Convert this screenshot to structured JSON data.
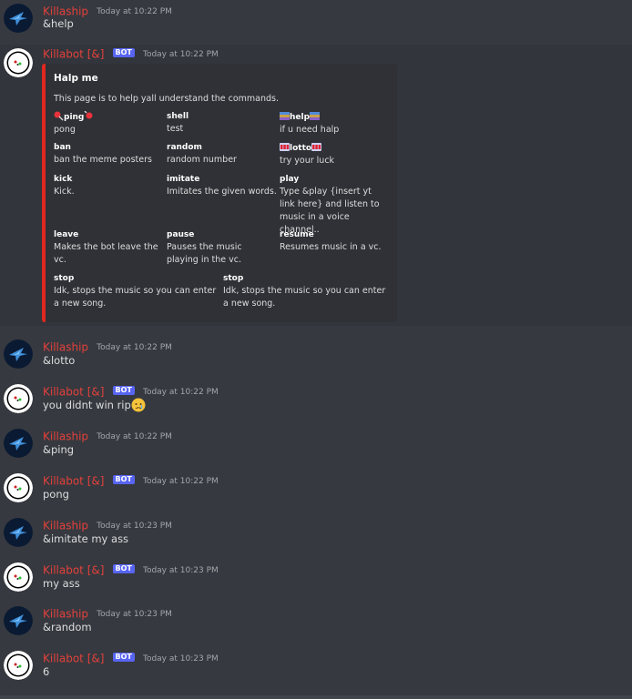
{
  "messages": [
    {
      "user": "Killaship",
      "bot": false,
      "time": "Today at 10:22 PM",
      "text": "&help"
    },
    {
      "user": "Killabot [&]",
      "bot": true,
      "time": "Today at 10:22 PM",
      "text": ""
    },
    {
      "user": "Killaship",
      "bot": false,
      "time": "Today at 10:22 PM",
      "text": "&lotto"
    },
    {
      "user": "Killabot [&]",
      "bot": true,
      "time": "Today at 10:22 PM",
      "text": "you didnt win rip"
    },
    {
      "user": "Killaship",
      "bot": false,
      "time": "Today at 10:22 PM",
      "text": "&ping"
    },
    {
      "user": "Killabot [&]",
      "bot": true,
      "time": "Today at 10:22 PM",
      "text": "pong"
    },
    {
      "user": "Killaship",
      "bot": false,
      "time": "Today at 10:23 PM",
      "text": "&imitate my ass"
    },
    {
      "user": "Killabot [&]",
      "bot": true,
      "time": "Today at 10:23 PM",
      "text": "my ass"
    },
    {
      "user": "Killaship",
      "bot": false,
      "time": "Today at 10:23 PM",
      "text": "&random"
    },
    {
      "user": "Killabot [&]",
      "bot": true,
      "time": "Today at 10:23 PM",
      "text": "6"
    }
  ],
  "bot_tag": "BOT",
  "embed": {
    "title": "Halp me",
    "description": "This page is to help yall understand the commands.",
    "accent_color": "#e0281f",
    "fields": [
      {
        "name": "ping",
        "value": "pong",
        "emoji": "lollipop-icon"
      },
      {
        "name": "shell",
        "value": "test"
      },
      {
        "name": "help",
        "value": "if u need halp",
        "emoji": "books-icon"
      },
      {
        "name": "ban",
        "value": "ban the meme posters"
      },
      {
        "name": "random",
        "value": "random number"
      },
      {
        "name": "lotto",
        "value": "try your luck",
        "emoji": "slot-icon"
      },
      {
        "name": "kick",
        "value": "Kick."
      },
      {
        "name": "imitate",
        "value": "Imitates the given words."
      },
      {
        "name": "play",
        "value": "Type &play {insert yt link here} and listen to music in a voice channel.."
      },
      {
        "name": "leave",
        "value": "Makes the bot leave the vc."
      },
      {
        "name": "pause",
        "value": "Pauses the music playing in the vc."
      },
      {
        "name": "resume",
        "value": "Resumes music in a vc."
      },
      {
        "name": "stop",
        "value": "Idk, stops the music so you can enter a new song."
      },
      {
        "name": "stop",
        "value": "Idk, stops the music so you can enter a new song."
      }
    ]
  },
  "colors": {
    "background": "#36393f",
    "username": "#e3413c",
    "bot_tag": "#5865f2",
    "text": "#dcddde",
    "timestamp": "#a3a6aa"
  }
}
